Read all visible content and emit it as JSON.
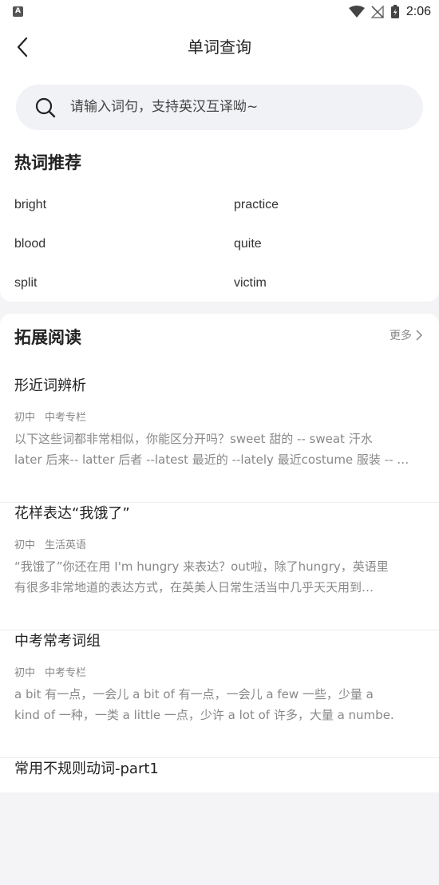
{
  "status_bar": {
    "app_badge": "A",
    "time": "2:06"
  },
  "header": {
    "title": "单词查询"
  },
  "search": {
    "placeholder": "请输入词句，支持英汉互译呦~"
  },
  "hot_words": {
    "title": "热词推荐",
    "items": [
      "bright",
      "practice",
      "blood",
      "quite",
      "split",
      "victim"
    ]
  },
  "reading": {
    "title": "拓展阅读",
    "more_label": "更多",
    "articles": [
      {
        "title": "形近词辨析",
        "tags": [
          "初中",
          "中考专栏"
        ],
        "desc_lines": [
          "以下这些词都非常相似，你能区分开吗？sweet 甜的 -- sweat 汗水",
          "later 后来-- latter 后者 --latest 最近的 --lately 最近costume 服装 -- …"
        ]
      },
      {
        "title": "花样表达“我饿了”",
        "tags": [
          "初中",
          "生活英语"
        ],
        "desc_lines": [
          "“我饿了”你还在用 I'm hungry 来表达？out啦，除了hungry，英语里",
          "有很多非常地道的表达方式，在英美人日常生活当中几乎天天用到…"
        ]
      },
      {
        "title": "中考常考词组",
        "tags": [
          "初中",
          "中考专栏"
        ],
        "desc_lines": [
          "a bit 有一点，一会儿 a bit of 有一点，一会儿 a few 一些，少量 a",
          "kind of 一种，一类 a little 一点，少许 a lot of 许多，大量 a numbe."
        ]
      },
      {
        "title": "常用不规则动词-part1",
        "tags": [],
        "desc_lines": []
      }
    ]
  }
}
